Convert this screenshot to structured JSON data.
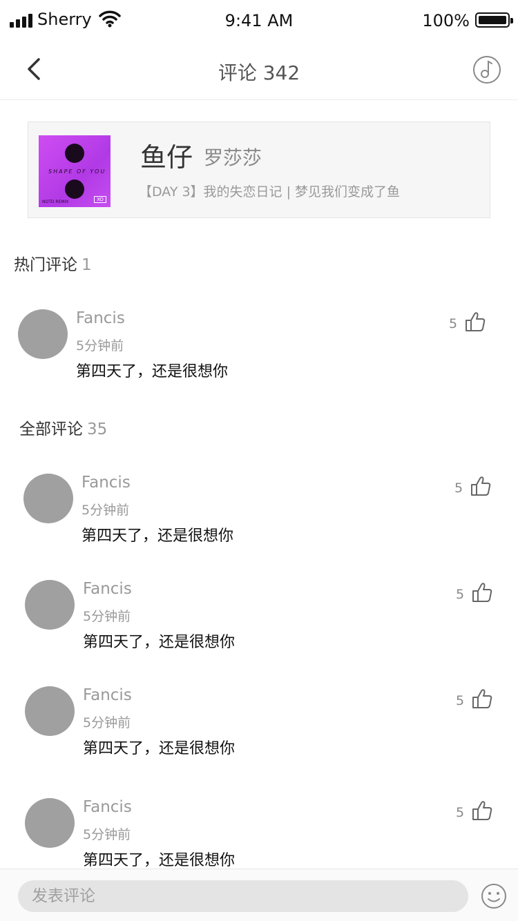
{
  "status_bar": {
    "carrier": "Sherry",
    "time": "9:41 AM",
    "battery": "100%"
  },
  "nav": {
    "title": "评论 342",
    "back_icon": "chevron-left-icon",
    "right_icon": "music-note-icon"
  },
  "song": {
    "title": "鱼仔",
    "artist": "罗莎莎",
    "description": "【DAY 3】我的失恋日记 | 梦见我们变成了鱼",
    "cover": {
      "title_text": "SHAPE OF YOU",
      "tag": "XO",
      "small_text": "NOTD REMIX",
      "accent": "#c64ef0"
    }
  },
  "hot_section": {
    "label": "热门评论",
    "count": "1"
  },
  "all_section": {
    "label": "全部评论",
    "count": "35"
  },
  "hot_comments": [
    {
      "name": "Fancis",
      "time": "5分钟前",
      "text": "第四天了，还是很想你",
      "likes": "5"
    }
  ],
  "all_comments": [
    {
      "name": "Fancis",
      "time": "5分钟前",
      "text": "第四天了，还是很想你",
      "likes": "5"
    },
    {
      "name": "Fancis",
      "time": "5分钟前",
      "text": "第四天了，还是很想你",
      "likes": "5"
    },
    {
      "name": "Fancis",
      "time": "5分钟前",
      "text": "第四天了，还是很想你",
      "likes": "5"
    },
    {
      "name": "Fancis",
      "time": "5分钟前",
      "text": "第四天了，还是很想你",
      "likes": "5"
    }
  ],
  "bottom_bar": {
    "placeholder": "发表评论",
    "emoji_icon": "smiley-icon"
  }
}
